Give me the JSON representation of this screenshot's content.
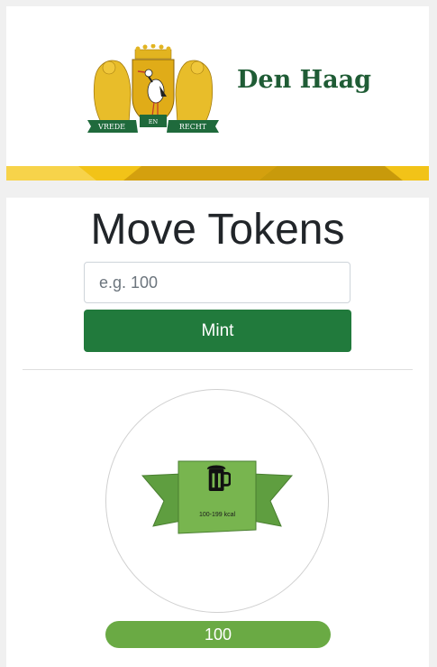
{
  "header": {
    "brand_name": "Den Haag",
    "logo_icon": "den-haag-coat-of-arms",
    "logo_motto": [
      "VREDE",
      "EN",
      "RECHT"
    ]
  },
  "main": {
    "title": "Move Tokens",
    "amount_input": {
      "placeholder": "e.g. 100",
      "value": ""
    },
    "mint_label": "Mint",
    "token": {
      "icon": "beer-mug-icon",
      "label": "100-199 kcal",
      "balance": "100"
    }
  },
  "colors": {
    "brand_green": "#1f5c35",
    "button_green": "#217a3c",
    "ribbon_green": "#6aaa44",
    "stripe_gold": "#f2c318"
  }
}
